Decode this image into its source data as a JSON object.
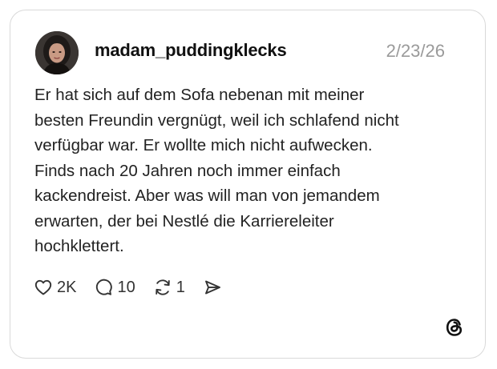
{
  "post": {
    "username": "madam_puddingklecks",
    "date": "2/23/26",
    "text_lines": [
      "Er hat sich auf dem Sofa nebenan mit meiner",
      "besten Freundin vergnügt, weil ich schlafend nicht",
      "verfügbar war. Er wollte mich nicht aufwecken.",
      "Finds nach 20 Jahren noch immer einfach",
      "kackendreist. Aber was will man von jemandem",
      "erwarten, der bei Nestlé die Karriereleiter",
      "hochklettert."
    ]
  },
  "actions": {
    "likes": "2K",
    "replies": "10",
    "reposts": "1",
    "like_icon": "heart-icon",
    "reply_icon": "comment-icon",
    "repost_icon": "repost-icon",
    "share_icon": "send-icon"
  },
  "branding": {
    "logo_icon": "threads-logo-icon"
  },
  "colors": {
    "text": "#222222",
    "date": "#9a9a9a",
    "border": "#d9d9d9"
  }
}
